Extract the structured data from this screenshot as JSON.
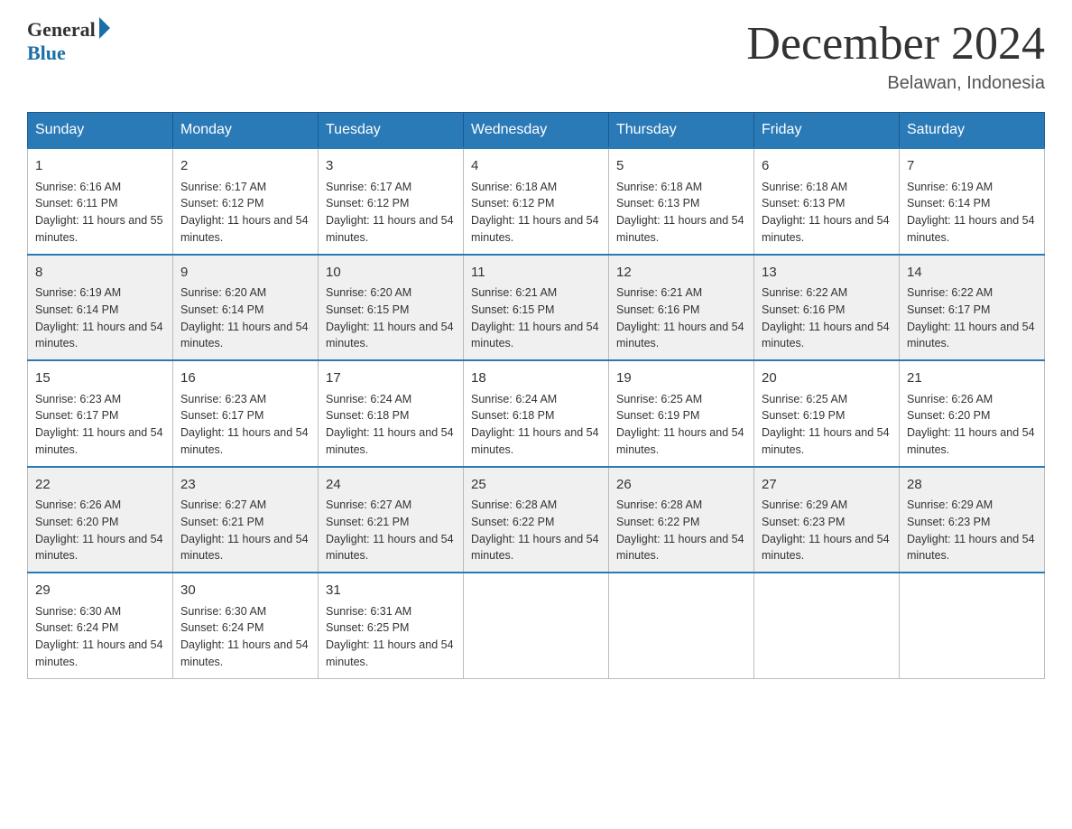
{
  "logo": {
    "general": "General",
    "blue": "Blue"
  },
  "title": "December 2024",
  "location": "Belawan, Indonesia",
  "days": [
    "Sunday",
    "Monday",
    "Tuesday",
    "Wednesday",
    "Thursday",
    "Friday",
    "Saturday"
  ],
  "weeks": [
    [
      {
        "day": 1,
        "sunrise": "6:16 AM",
        "sunset": "6:11 PM",
        "daylight": "11 hours and 55 minutes."
      },
      {
        "day": 2,
        "sunrise": "6:17 AM",
        "sunset": "6:12 PM",
        "daylight": "11 hours and 54 minutes."
      },
      {
        "day": 3,
        "sunrise": "6:17 AM",
        "sunset": "6:12 PM",
        "daylight": "11 hours and 54 minutes."
      },
      {
        "day": 4,
        "sunrise": "6:18 AM",
        "sunset": "6:12 PM",
        "daylight": "11 hours and 54 minutes."
      },
      {
        "day": 5,
        "sunrise": "6:18 AM",
        "sunset": "6:13 PM",
        "daylight": "11 hours and 54 minutes."
      },
      {
        "day": 6,
        "sunrise": "6:18 AM",
        "sunset": "6:13 PM",
        "daylight": "11 hours and 54 minutes."
      },
      {
        "day": 7,
        "sunrise": "6:19 AM",
        "sunset": "6:14 PM",
        "daylight": "11 hours and 54 minutes."
      }
    ],
    [
      {
        "day": 8,
        "sunrise": "6:19 AM",
        "sunset": "6:14 PM",
        "daylight": "11 hours and 54 minutes."
      },
      {
        "day": 9,
        "sunrise": "6:20 AM",
        "sunset": "6:14 PM",
        "daylight": "11 hours and 54 minutes."
      },
      {
        "day": 10,
        "sunrise": "6:20 AM",
        "sunset": "6:15 PM",
        "daylight": "11 hours and 54 minutes."
      },
      {
        "day": 11,
        "sunrise": "6:21 AM",
        "sunset": "6:15 PM",
        "daylight": "11 hours and 54 minutes."
      },
      {
        "day": 12,
        "sunrise": "6:21 AM",
        "sunset": "6:16 PM",
        "daylight": "11 hours and 54 minutes."
      },
      {
        "day": 13,
        "sunrise": "6:22 AM",
        "sunset": "6:16 PM",
        "daylight": "11 hours and 54 minutes."
      },
      {
        "day": 14,
        "sunrise": "6:22 AM",
        "sunset": "6:17 PM",
        "daylight": "11 hours and 54 minutes."
      }
    ],
    [
      {
        "day": 15,
        "sunrise": "6:23 AM",
        "sunset": "6:17 PM",
        "daylight": "11 hours and 54 minutes."
      },
      {
        "day": 16,
        "sunrise": "6:23 AM",
        "sunset": "6:17 PM",
        "daylight": "11 hours and 54 minutes."
      },
      {
        "day": 17,
        "sunrise": "6:24 AM",
        "sunset": "6:18 PM",
        "daylight": "11 hours and 54 minutes."
      },
      {
        "day": 18,
        "sunrise": "6:24 AM",
        "sunset": "6:18 PM",
        "daylight": "11 hours and 54 minutes."
      },
      {
        "day": 19,
        "sunrise": "6:25 AM",
        "sunset": "6:19 PM",
        "daylight": "11 hours and 54 minutes."
      },
      {
        "day": 20,
        "sunrise": "6:25 AM",
        "sunset": "6:19 PM",
        "daylight": "11 hours and 54 minutes."
      },
      {
        "day": 21,
        "sunrise": "6:26 AM",
        "sunset": "6:20 PM",
        "daylight": "11 hours and 54 minutes."
      }
    ],
    [
      {
        "day": 22,
        "sunrise": "6:26 AM",
        "sunset": "6:20 PM",
        "daylight": "11 hours and 54 minutes."
      },
      {
        "day": 23,
        "sunrise": "6:27 AM",
        "sunset": "6:21 PM",
        "daylight": "11 hours and 54 minutes."
      },
      {
        "day": 24,
        "sunrise": "6:27 AM",
        "sunset": "6:21 PM",
        "daylight": "11 hours and 54 minutes."
      },
      {
        "day": 25,
        "sunrise": "6:28 AM",
        "sunset": "6:22 PM",
        "daylight": "11 hours and 54 minutes."
      },
      {
        "day": 26,
        "sunrise": "6:28 AM",
        "sunset": "6:22 PM",
        "daylight": "11 hours and 54 minutes."
      },
      {
        "day": 27,
        "sunrise": "6:29 AM",
        "sunset": "6:23 PM",
        "daylight": "11 hours and 54 minutes."
      },
      {
        "day": 28,
        "sunrise": "6:29 AM",
        "sunset": "6:23 PM",
        "daylight": "11 hours and 54 minutes."
      }
    ],
    [
      {
        "day": 29,
        "sunrise": "6:30 AM",
        "sunset": "6:24 PM",
        "daylight": "11 hours and 54 minutes."
      },
      {
        "day": 30,
        "sunrise": "6:30 AM",
        "sunset": "6:24 PM",
        "daylight": "11 hours and 54 minutes."
      },
      {
        "day": 31,
        "sunrise": "6:31 AM",
        "sunset": "6:25 PM",
        "daylight": "11 hours and 54 minutes."
      },
      null,
      null,
      null,
      null
    ]
  ]
}
